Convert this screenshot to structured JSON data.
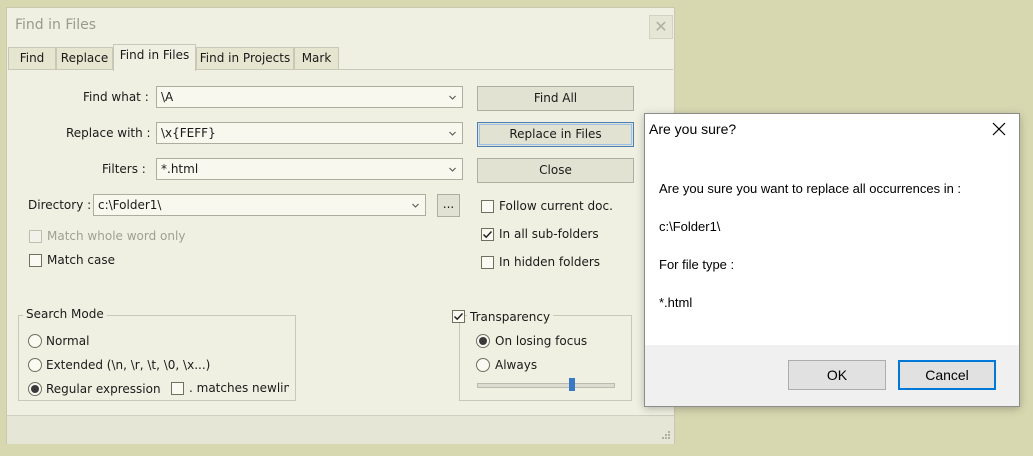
{
  "find_dialog": {
    "title": "Find in Files",
    "tabs": [
      "Find",
      "Replace",
      "Find in Files",
      "Find in Projects",
      "Mark"
    ],
    "active_tab": "Find in Files",
    "find_what": {
      "label": "Find what :",
      "value": "\\A"
    },
    "replace_with": {
      "label": "Replace with :",
      "value": "\\x{FEFF}"
    },
    "filters": {
      "label": "Filters :",
      "value": "*.html"
    },
    "directory": {
      "label": "Directory :",
      "value": "c:\\Folder1\\",
      "browse": "..."
    },
    "buttons": {
      "find_all": "Find All",
      "replace_in_files": "Replace in Files",
      "close": "Close"
    },
    "options": {
      "match_whole_word": {
        "label": "Match whole word only",
        "checked": false,
        "enabled": false
      },
      "match_case": {
        "label": "Match case",
        "checked": false
      },
      "follow_current_doc": {
        "label": "Follow current doc.",
        "checked": false
      },
      "in_all_subfolders": {
        "label": "In all sub-folders",
        "checked": true
      },
      "in_hidden_folders": {
        "label": "In hidden folders",
        "checked": false
      }
    },
    "search_mode": {
      "title": "Search Mode",
      "normal": "Normal",
      "extended": "Extended (\\n, \\r, \\t, \\0, \\x...)",
      "regex": "Regular expression",
      "matches_newline": ". matches newline",
      "selected": "Regular expression"
    },
    "transparency": {
      "title": "Transparency",
      "checked": true,
      "on_losing_focus": "On losing focus",
      "always": "Always",
      "selected": "On losing focus",
      "slider_level": 0.7
    }
  },
  "confirm_dialog": {
    "title": "Are you sure?",
    "message": "Are you sure you want to replace all occurrences in :",
    "path": "c:\\Folder1\\",
    "file_type_label": "For file type :",
    "file_type": "*.html",
    "ok": "OK",
    "cancel": "Cancel"
  },
  "colors": {
    "desktop": "#d8d8b0",
    "dialog_bg": "#f0f0e2",
    "focus_accent": "#0078d7"
  },
  "icons": [
    "close-icon",
    "chevron-down-icon",
    "checkmark-icon",
    "resize-grip-icon"
  ]
}
